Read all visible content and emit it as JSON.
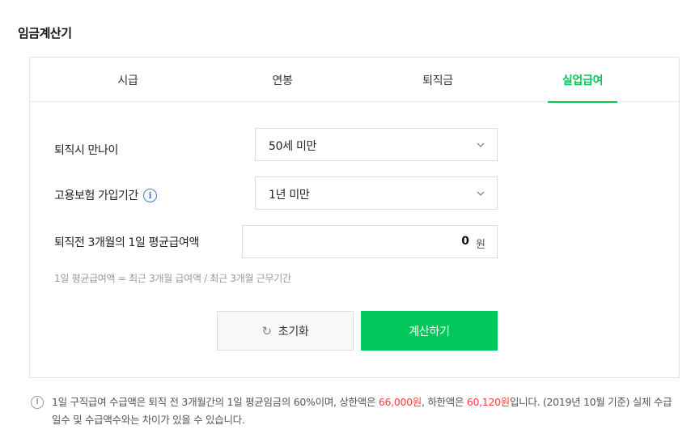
{
  "page_title": "임금계산기",
  "tabs": [
    {
      "label": "시급",
      "active": false
    },
    {
      "label": "연봉",
      "active": false
    },
    {
      "label": "퇴직금",
      "active": false
    },
    {
      "label": "실업급여",
      "active": true
    }
  ],
  "form": {
    "age_label": "퇴직시 만나이",
    "age_value": "50세 미만",
    "insurance_label": "고용보험 가입기간",
    "insurance_info_icon": "i",
    "insurance_value": "1년 미만",
    "wage_label": "퇴직전 3개월의 1일 평균급여액",
    "wage_value": "0",
    "wage_unit": "원",
    "formula": "1일 평균급여액 = 최근 3개월 급여액 / 최근 3개월 근무기간"
  },
  "buttons": {
    "reset_icon": "↻",
    "reset_label": "초기화",
    "calc_label": "계산하기"
  },
  "notice": {
    "icon": "!",
    "part1": "1일 구직급여 수급액은 퇴직 전 3개월간의 1일 평균임금의 60%이며, 상한액은 ",
    "max_amount": "66,000원",
    "part2": ", 하한액은 ",
    "min_amount": "60,120원",
    "part3": "입니다. (2019년 10월 기준) 실제 수급일수 및 수급액수와는 차이가 있을 수 있습니다."
  },
  "colors": {
    "accent": "#03c75a",
    "highlight": "#ff3c3c",
    "info": "#3b7de9"
  }
}
